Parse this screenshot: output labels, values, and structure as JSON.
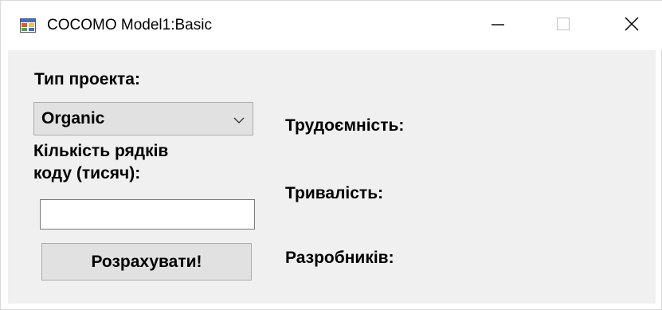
{
  "window": {
    "title": "COCOMO Model1:Basic",
    "icon": "app-window-icon",
    "controls": {
      "minimize_icon": "minimize-icon",
      "maximize_icon": "maximize-icon",
      "close_icon": "close-icon"
    }
  },
  "form": {
    "project_type_label": "Тип проекта:",
    "project_type_value": "Organic",
    "lines_label_line1": "Кількість рядків",
    "lines_label_line2": "коду (тисяч):",
    "lines_value": "",
    "calculate_label": "Розрахувати!"
  },
  "results": {
    "effort_label": "Трудоємність:",
    "duration_label": "Тривалість:",
    "developers_label": "Разробників:"
  },
  "colors": {
    "client_background": "#f0f0f0",
    "button_background": "#e1e1e1",
    "control_border": "#adadad"
  }
}
